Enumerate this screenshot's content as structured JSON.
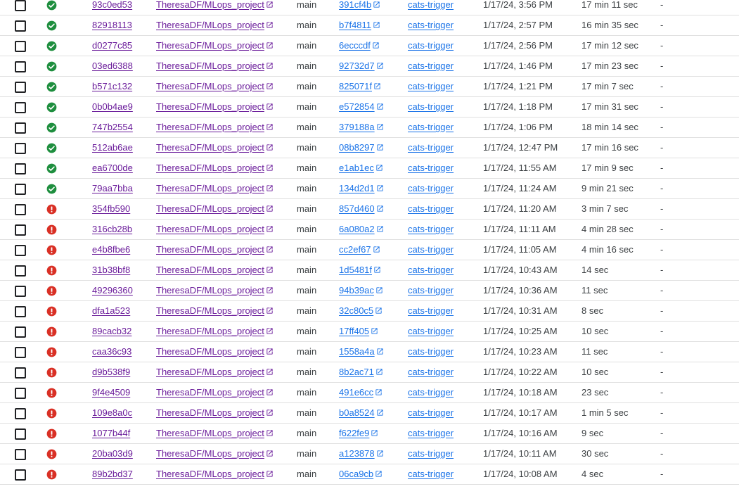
{
  "colors": {
    "success": "#1e8e3e",
    "error": "#d93025",
    "visited_link": "#6a1b9a",
    "link": "#1a73e8"
  },
  "icons": {
    "success": "check-circle-icon",
    "error": "error-circle-icon",
    "external": "open-in-new-icon",
    "checkbox": "checkbox-icon"
  },
  "rows": [
    {
      "status": "success",
      "build": "93c0ed53",
      "repo": "TheresaDF/MLops_project",
      "branch": "main",
      "commit": "391cf4b",
      "trigger": "cats-trigger",
      "created": "1/17/24, 3:56 PM",
      "duration": "17 min 11 sec",
      "tags": "-"
    },
    {
      "status": "success",
      "build": "82918113",
      "repo": "TheresaDF/MLops_project",
      "branch": "main",
      "commit": "b7f4811",
      "trigger": "cats-trigger",
      "created": "1/17/24, 2:57 PM",
      "duration": "16 min 35 sec",
      "tags": "-"
    },
    {
      "status": "success",
      "build": "d0277c85",
      "repo": "TheresaDF/MLops_project",
      "branch": "main",
      "commit": "6ecccdf",
      "trigger": "cats-trigger",
      "created": "1/17/24, 2:56 PM",
      "duration": "17 min 12 sec",
      "tags": "-"
    },
    {
      "status": "success",
      "build": "03ed6388",
      "repo": "TheresaDF/MLops_project",
      "branch": "main",
      "commit": "92732d7",
      "trigger": "cats-trigger",
      "created": "1/17/24, 1:46 PM",
      "duration": "17 min 23 sec",
      "tags": "-"
    },
    {
      "status": "success",
      "build": "b571c132",
      "repo": "TheresaDF/MLops_project",
      "branch": "main",
      "commit": "825071f",
      "trigger": "cats-trigger",
      "created": "1/17/24, 1:21 PM",
      "duration": "17 min 7 sec",
      "tags": "-"
    },
    {
      "status": "success",
      "build": "0b0b4ae9",
      "repo": "TheresaDF/MLops_project",
      "branch": "main",
      "commit": "e572854",
      "trigger": "cats-trigger",
      "created": "1/17/24, 1:18 PM",
      "duration": "17 min 31 sec",
      "tags": "-"
    },
    {
      "status": "success",
      "build": "747b2554",
      "repo": "TheresaDF/MLops_project",
      "branch": "main",
      "commit": "379188a",
      "trigger": "cats-trigger",
      "created": "1/17/24, 1:06 PM",
      "duration": "18 min 14 sec",
      "tags": "-"
    },
    {
      "status": "success",
      "build": "512ab6ae",
      "repo": "TheresaDF/MLops_project",
      "branch": "main",
      "commit": "08b8297",
      "trigger": "cats-trigger",
      "created": "1/17/24, 12:47 PM",
      "duration": "17 min 16 sec",
      "tags": "-"
    },
    {
      "status": "success",
      "build": "ea6700de",
      "repo": "TheresaDF/MLops_project",
      "branch": "main",
      "commit": "e1ab1ec",
      "trigger": "cats-trigger",
      "created": "1/17/24, 11:55 AM",
      "duration": "17 min 9 sec",
      "tags": "-"
    },
    {
      "status": "success",
      "build": "79aa7bba",
      "repo": "TheresaDF/MLops_project",
      "branch": "main",
      "commit": "134d2d1",
      "trigger": "cats-trigger",
      "created": "1/17/24, 11:24 AM",
      "duration": "9 min 21 sec",
      "tags": "-"
    },
    {
      "status": "error",
      "build": "354fb590",
      "repo": "TheresaDF/MLops_project",
      "branch": "main",
      "commit": "857d460",
      "trigger": "cats-trigger",
      "created": "1/17/24, 11:20 AM",
      "duration": "3 min 7 sec",
      "tags": "-"
    },
    {
      "status": "error",
      "build": "316cb28b",
      "repo": "TheresaDF/MLops_project",
      "branch": "main",
      "commit": "6a080a2",
      "trigger": "cats-trigger",
      "created": "1/17/24, 11:11 AM",
      "duration": "4 min 28 sec",
      "tags": "-"
    },
    {
      "status": "error",
      "build": "e4b8fbe6",
      "repo": "TheresaDF/MLops_project",
      "branch": "main",
      "commit": "cc2ef67",
      "trigger": "cats-trigger",
      "created": "1/17/24, 11:05 AM",
      "duration": "4 min 16 sec",
      "tags": "-"
    },
    {
      "status": "error",
      "build": "31b38bf8",
      "repo": "TheresaDF/MLops_project",
      "branch": "main",
      "commit": "1d5481f",
      "trigger": "cats-trigger",
      "created": "1/17/24, 10:43 AM",
      "duration": "14 sec",
      "tags": "-"
    },
    {
      "status": "error",
      "build": "49296360",
      "repo": "TheresaDF/MLops_project",
      "branch": "main",
      "commit": "94b39ac",
      "trigger": "cats-trigger",
      "created": "1/17/24, 10:36 AM",
      "duration": "11 sec",
      "tags": "-"
    },
    {
      "status": "error",
      "build": "dfa1a523",
      "repo": "TheresaDF/MLops_project",
      "branch": "main",
      "commit": "32c80c5",
      "trigger": "cats-trigger",
      "created": "1/17/24, 10:31 AM",
      "duration": "8 sec",
      "tags": "-"
    },
    {
      "status": "error",
      "build": "89cacb32",
      "repo": "TheresaDF/MLops_project",
      "branch": "main",
      "commit": "17ff405",
      "trigger": "cats-trigger",
      "created": "1/17/24, 10:25 AM",
      "duration": "10 sec",
      "tags": "-"
    },
    {
      "status": "error",
      "build": "caa36c93",
      "repo": "TheresaDF/MLops_project",
      "branch": "main",
      "commit": "1558a4a",
      "trigger": "cats-trigger",
      "created": "1/17/24, 10:23 AM",
      "duration": "11 sec",
      "tags": "-"
    },
    {
      "status": "error",
      "build": "d9b538f9",
      "repo": "TheresaDF/MLops_project",
      "branch": "main",
      "commit": "8b2ac71",
      "trigger": "cats-trigger",
      "created": "1/17/24, 10:22 AM",
      "duration": "10 sec",
      "tags": "-"
    },
    {
      "status": "error",
      "build": "9f4e4509",
      "repo": "TheresaDF/MLops_project",
      "branch": "main",
      "commit": "491e6cc",
      "trigger": "cats-trigger",
      "created": "1/17/24, 10:18 AM",
      "duration": "23 sec",
      "tags": "-"
    },
    {
      "status": "error",
      "build": "109e8a0c",
      "repo": "TheresaDF/MLops_project",
      "branch": "main",
      "commit": "b0a8524",
      "trigger": "cats-trigger",
      "created": "1/17/24, 10:17 AM",
      "duration": "1 min 5 sec",
      "tags": "-"
    },
    {
      "status": "error",
      "build": "1077b44f",
      "repo": "TheresaDF/MLops_project",
      "branch": "main",
      "commit": "f622fe9",
      "trigger": "cats-trigger",
      "created": "1/17/24, 10:16 AM",
      "duration": "9 sec",
      "tags": "-"
    },
    {
      "status": "error",
      "build": "20ba03d9",
      "repo": "TheresaDF/MLops_project",
      "branch": "main",
      "commit": "a123878",
      "trigger": "cats-trigger",
      "created": "1/17/24, 10:11 AM",
      "duration": "30 sec",
      "tags": "-"
    },
    {
      "status": "error",
      "build": "89b2bd37",
      "repo": "TheresaDF/MLops_project",
      "branch": "main",
      "commit": "06ca9cb",
      "trigger": "cats-trigger",
      "created": "1/17/24, 10:08 AM",
      "duration": "4 sec",
      "tags": "-"
    }
  ]
}
